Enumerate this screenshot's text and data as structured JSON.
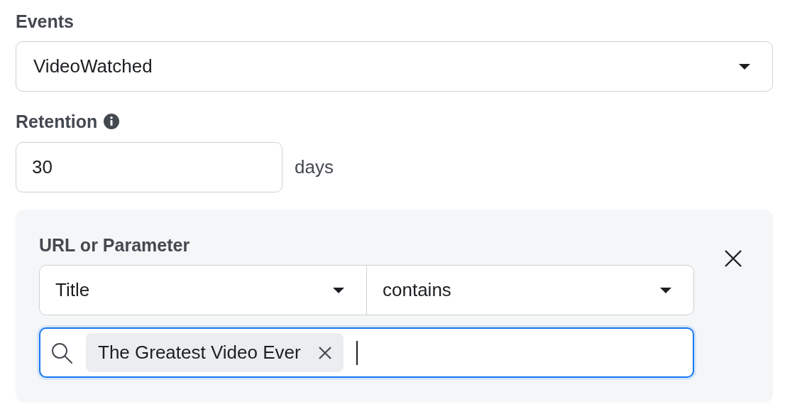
{
  "events": {
    "label": "Events",
    "value": "VideoWatched"
  },
  "retention": {
    "label": "Retention",
    "value": "30",
    "unit": "days"
  },
  "rule": {
    "label": "URL or Parameter",
    "field": "Title",
    "operator": "contains",
    "focused": true,
    "tags": [
      {
        "text": "The Greatest Video Ever"
      }
    ]
  }
}
